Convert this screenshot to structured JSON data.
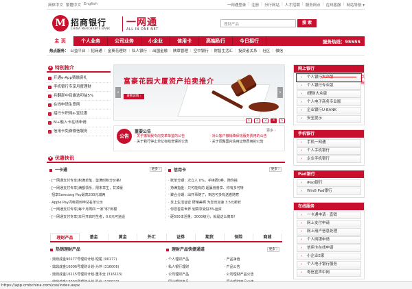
{
  "topbar": {
    "lang": [
      "简体中文",
      "繁體中文",
      "English"
    ],
    "links": [
      "一网通登录",
      "注册",
      "分行网站",
      "人才招聘",
      "服务网点",
      "在线客服",
      "网站导航 ▾"
    ]
  },
  "logo": {
    "mark": "M",
    "name": "招商银行",
    "en": "CHINA MERCHANTS BANK",
    "allinone": "一网通",
    "allinone_en": "ALL IN ONE NET"
  },
  "search": {
    "placeholder": "理财产品",
    "button": "搜 索"
  },
  "mainnav": {
    "items": [
      "主 页",
      "个人业务",
      "公司业务",
      "小企业",
      "信用卡",
      "高端私行",
      "今日招行"
    ],
    "hotline": "服务热线：95555"
  },
  "subnav": {
    "hot": "热点服务：",
    "items": [
      "公益平台",
      "招商通",
      "金葵花理财",
      "私人银行",
      "出国金融",
      "陕章管理",
      "空中银行",
      "财智生活汇",
      "投资者关系",
      "社区",
      "微信"
    ]
  },
  "promo": {
    "title": "特别推介",
    "items": [
      "开通e-App猜融资礼",
      "手机银行专享月度理财",
      "兵翻部中目露选叩益5%",
      "在线申请生意网",
      "招行卡积网e-宝优惠",
      "M+融入卡在线申请",
      "信用卡免费微信服务"
    ]
  },
  "banner": {
    "title": "富豪花园大厦资产拍卖推介",
    "button": "查看详情 ›",
    "dots": [
      "1",
      "2",
      "3",
      "4",
      "5"
    ]
  },
  "notice": {
    "head": "重要公告",
    "more": "更多 ›",
    "items": [
      {
        "text": "· 关于撤销我专向变革单鉴的公告",
        "red": true
      },
      {
        "text": "· 对公客户撤销降保钱服务费用的公告",
        "red": true
      },
      {
        "text": "· 关于我行停止单亿标结增保的公告",
        "red": false
      },
      {
        "text": "· 关于调整国内信用证修费用的公告",
        "red": false
      }
    ]
  },
  "right": {
    "netbank": {
      "title": "网上银行",
      "items": [
        "个人银行大众版",
        "个人银行专业版",
        "I理财大众版",
        "个人电子商务专业版",
        "企业银行U-BANK",
        "安全提示"
      ]
    },
    "mobile": {
      "title": "手机银行",
      "items": [
        "手机一网通",
        "个人手机银行",
        "企业手机银行"
      ]
    },
    "pad": {
      "title": "Pad银行",
      "items": [
        "iPad银行",
        "Win8 Pad银行"
      ]
    },
    "online": {
      "title": "在线服务",
      "items": [
        "一卡通申请 · 直销",
        "网上支付申请",
        "网上用户信息处理",
        "个人网银申请",
        "信用卡在线申请",
        "小企业E家",
        "个人电子银行服务",
        "粤信宣声中网"
      ]
    }
  },
  "annotation": {
    "label": "点击"
  },
  "offers": {
    "title": "优惠快讯",
    "left": {
      "head": "一卡通",
      "more": "更多 ›",
      "items": [
        "· [一网通支付专享]积满单笔，鉴满时积分价格！",
        "· [一网通支付专享]满额领乐，限末享生，甘掉豪",
        "· 招享Samsung Pay最高200元减两",
        "· Apple Pay闪电领到申试名单公示",
        "· [一网通支付专享]每个月周四 一家\"积\"到模",
        "· [一网通支付专享]本月开启时生者，0.0元可逍遥"
      ]
    },
    "right": {
      "head": "信用卡",
      "more": "更多 ›",
      "items": [
        "· 账单分期：次立人 0%，手续费0券，随你挑",
        "· 持满指金：只可能有的 超赢普普享、你有多可特",
        "· 聚合分期：出开事随了，到店可多有送者随意",
        "· 享上生活证密 研精美啊 为您出加速 3.5元新鲜",
        "· 你您善意世界 划算享受好3%运资",
        "· 砸500本活量，3000级分，就是这么简单！"
      ]
    }
  },
  "tabs": [
    "理财产品",
    "基金",
    "黄金",
    "外汇",
    "证券",
    "期货",
    "保险",
    "商城"
  ],
  "products": {
    "hot": {
      "head": "热销理财产品",
      "items": [
        "· 鼎鼎成金90177号理财计划-短尾 (90177)",
        "· 鼎鼎成金16006号理财计划-为冲 (316006)",
        "· 鼎鼎成金16115号理财计划-重本全 (316115)",
        "· 鼎鼎成金12003号理财计划-股份 (120027)"
      ]
    },
    "quick": {
      "head": "理财产品快捷通道",
      "more": "更多 ›",
      "col1": [
        "· 个人理财产品",
        "· 私人银行理财",
        "· 公司理财产品",
        "· 同业理财产品"
      ],
      "col2": [
        "· 产品净值",
        "· 产品公告",
        "· 公司理财产品公告",
        "· 同业理财产品公告"
      ]
    }
  },
  "statusbar": {
    "url": "https://app.cmbchina.com/css/index.aspx"
  }
}
